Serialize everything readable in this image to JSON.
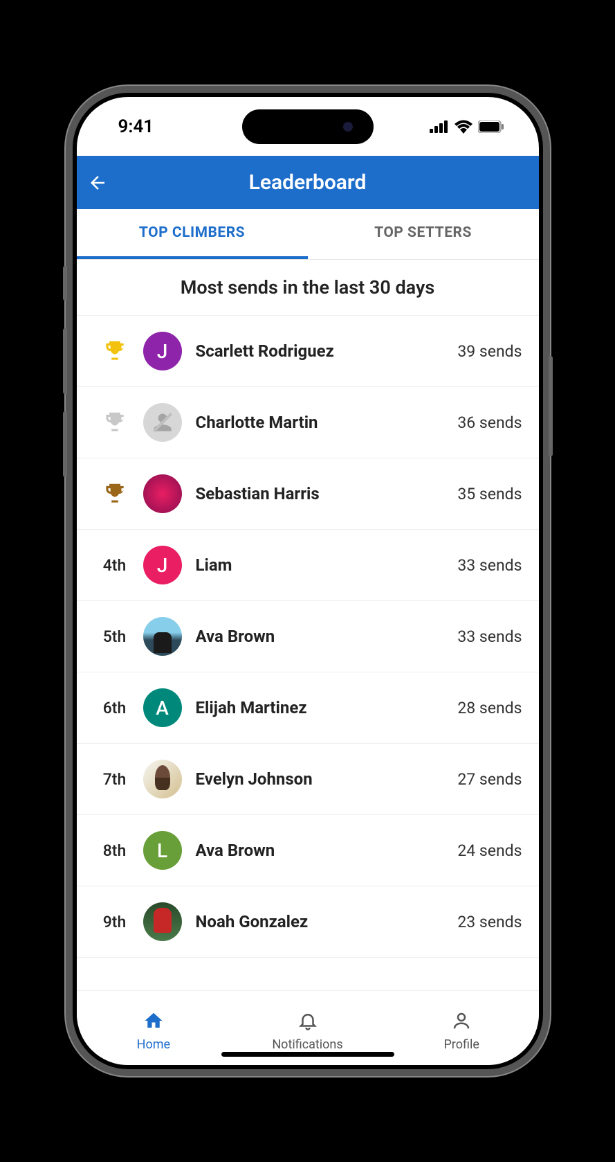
{
  "status": {
    "time": "9:41"
  },
  "header": {
    "title": "Leaderboard"
  },
  "tabs": [
    {
      "label": "TOP CLIMBERS",
      "active": true
    },
    {
      "label": "TOP SETTERS",
      "active": false
    }
  ],
  "subtitle": "Most sends in the last 30 days",
  "leaderboard": [
    {
      "rank": "1",
      "trophy": "gold",
      "name": "Scarlett Rodriguez",
      "sends": "39 sends",
      "avatar": {
        "type": "letter",
        "letter": "J",
        "bg": "#8e24aa"
      }
    },
    {
      "rank": "2",
      "trophy": "silver",
      "name": "Charlotte Martin",
      "sends": "36 sends",
      "avatar": {
        "type": "placeholder"
      }
    },
    {
      "rank": "3",
      "trophy": "bronze",
      "name": "Sebastian Harris",
      "sends": "35 sends",
      "avatar": {
        "type": "photo",
        "cls": "photo3"
      }
    },
    {
      "rank": "4th",
      "name": "Liam",
      "sends": "33 sends",
      "avatar": {
        "type": "letter",
        "letter": "J",
        "bg": "#e91e63"
      }
    },
    {
      "rank": "5th",
      "name": "Ava Brown",
      "sends": "33 sends",
      "avatar": {
        "type": "photo",
        "cls": "photo1"
      }
    },
    {
      "rank": "6th",
      "name": "Elijah Martinez",
      "sends": "28 sends",
      "avatar": {
        "type": "letter",
        "letter": "A",
        "bg": "#00897b"
      }
    },
    {
      "rank": "7th",
      "name": "Evelyn Johnson",
      "sends": "27 sends",
      "avatar": {
        "type": "photo",
        "cls": "photo2"
      }
    },
    {
      "rank": "8th",
      "name": "Ava Brown",
      "sends": "24 sends",
      "avatar": {
        "type": "letter",
        "letter": "L",
        "bg": "#689f38"
      }
    },
    {
      "rank": "9th",
      "name": "Noah Gonzalez",
      "sends": "23 sends",
      "avatar": {
        "type": "photo",
        "cls": "photo4"
      }
    }
  ],
  "nav": [
    {
      "label": "Home",
      "icon": "home",
      "active": true
    },
    {
      "label": "Notifications",
      "icon": "bell",
      "active": false
    },
    {
      "label": "Profile",
      "icon": "person",
      "active": false
    }
  ],
  "trophy_colors": {
    "gold": "#f2c20c",
    "silver": "#c8c8c8",
    "bronze": "#9a661a"
  }
}
